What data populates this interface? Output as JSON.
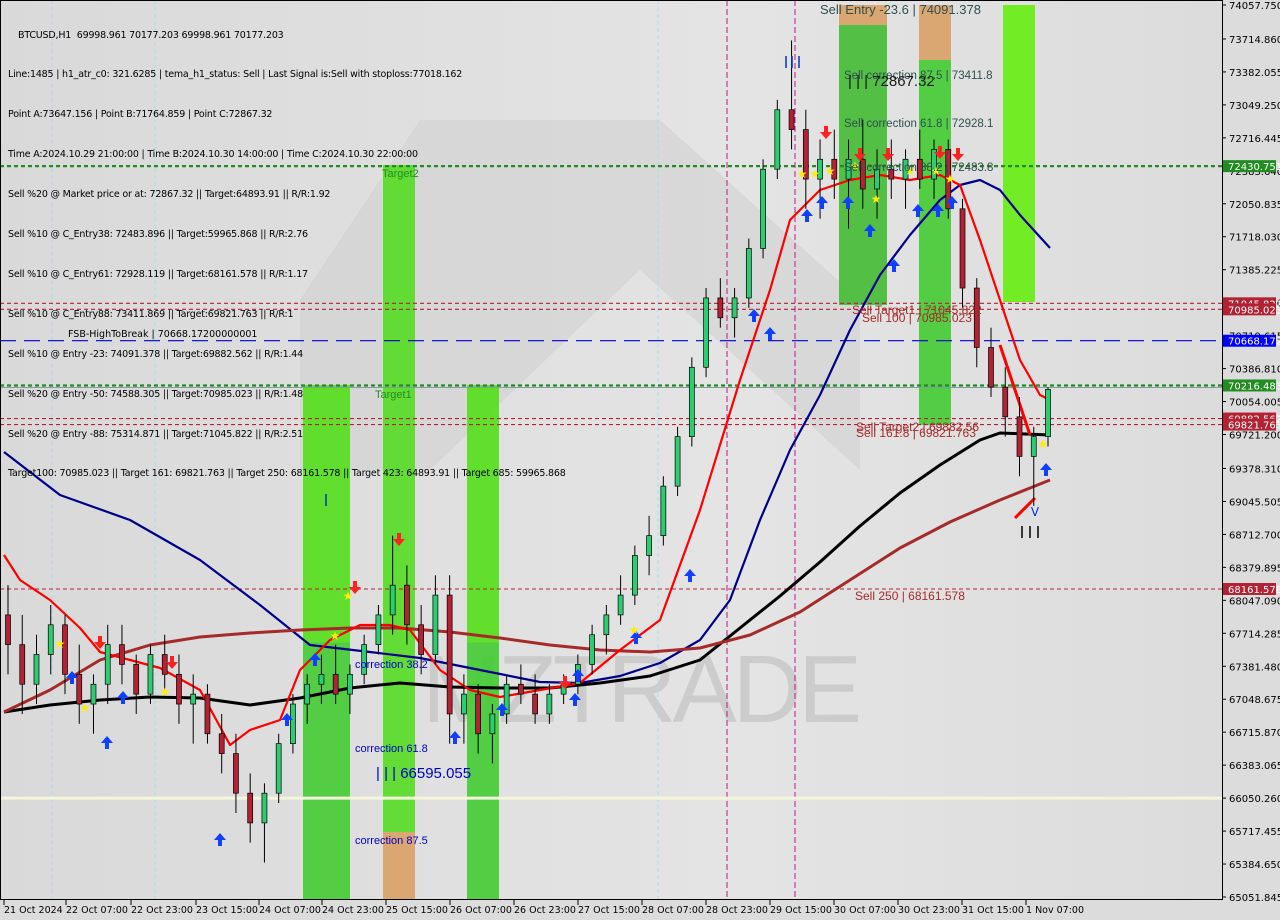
{
  "window": {
    "symbol": "BTCUSD,H1",
    "ohlc": "69998.961 70177.203 69998.961 70177.203"
  },
  "info_lines": [
    "Line:1485 | h1_atr_c0: 321.6285 | tema_h1_status: Sell | Last Signal is:Sell with stoploss:77018.162",
    "Point A:73647.156 | Point B:71764.859 | Point C:72867.32",
    "Time A:2024.10.29 21:00:00 | Time B:2024.10.30 14:00:00 | Time C:2024.10.30 22:00:00",
    "Sell %20 @ Market price or at: 72867.32 || Target:64893.91 || R/R:1.92",
    "Sell %10 @ C_Entry38: 72483.896 || Target:59965.868 || R/R:2.76",
    "Sell %10 @ C_Entry61: 72928.119 || Target:68161.578 || R/R:1.17",
    "Sell %10 @ C_Entry88: 73411.869 || Target:69821.763 || R/R:1",
    "Sell %10 @ Entry -23: 74091.378 || Target:69882.562 || R/R:1.44",
    "Sell %20 @ Entry -50: 74588.305 || Target:70985.023 || R/R:1.48",
    "Sell %20 @ Entry -88: 75314.871 || Target:71045.822 || R/R:2.51",
    "Target100: 70985.023 || Target 161: 69821.763 || Target 250: 68161.578 || Target 423: 64893.91 || Target 685: 59965.868"
  ],
  "colors": {
    "background": "#dcdcdc",
    "bull_candle": "#2ecc71",
    "bear_candle": "#b22234",
    "ema_fast": "#ff0000",
    "ema_mid": "#00008b",
    "ema_slow": "#000000",
    "ema_long": "#a52a2a",
    "green_zone": "#44cc33",
    "orange_zone": "#d9a066",
    "target_line": "#228b22",
    "sell_line": "#b22234",
    "fsb_line": "#0000cd",
    "buy_arrow": "#1040ff",
    "sell_arrow": "#ff2020",
    "star": "#ffee00"
  },
  "watermark": "MZTRADE",
  "chart_data": {
    "type": "candlestick",
    "title": "BTCUSD,H1",
    "xlabel": "",
    "ylabel": "",
    "ylim": [
      65051.845,
      74057.75
    ],
    "grid": false,
    "y_ticks": [
      "74057.750",
      "73714.860",
      "73382.055",
      "73049.250",
      "72716.445",
      "72383.640",
      "72050.835",
      "71718.030",
      "71385.225",
      "71052.420",
      "70719.615",
      "70386.810",
      "70054.005",
      "69721.200",
      "69378.310",
      "69045.505",
      "68712.700",
      "68379.895",
      "68047.090",
      "67714.285",
      "67381.480",
      "67048.675",
      "66715.870",
      "66383.065",
      "66050.260",
      "65717.455",
      "65384.650",
      "65051.845"
    ],
    "x_ticks": [
      "21 Oct 2024",
      "22 Oct 07:00",
      "22 Oct 23:00",
      "23 Oct 15:00",
      "24 Oct 07:00",
      "24 Oct 23:00",
      "25 Oct 15:00",
      "26 Oct 07:00",
      "26 Oct 23:00",
      "27 Oct 15:00",
      "28 Oct 07:00",
      "28 Oct 23:00",
      "29 Oct 15:00",
      "30 Oct 07:00",
      "30 Oct 23:00",
      "31 Oct 15:00",
      "1 Nov 07:00"
    ],
    "price_tags": [
      {
        "value": 72430.751,
        "label": "72430.751",
        "color": "#228b22"
      },
      {
        "value": 71045.822,
        "label": "71045.822",
        "color": "#b22234"
      },
      {
        "value": 70985.023,
        "label": "70985.023",
        "color": "#b22234"
      },
      {
        "value": 70668.172,
        "label": "70668.172",
        "color": "#0000ff"
      },
      {
        "value": 70216.483,
        "label": "70216.483",
        "color": "#228b22"
      },
      {
        "value": 69882.562,
        "label": "69882.562",
        "color": "#b22234"
      },
      {
        "value": 69821.763,
        "label": "69821.763",
        "color": "#b22234"
      },
      {
        "value": 68161.578,
        "label": "68161.578",
        "color": "#b22234"
      }
    ],
    "horizontal_lines": [
      {
        "value": 72430.751,
        "style": "dotted",
        "color": "#228b22",
        "label": "Target2"
      },
      {
        "value": 71045.822,
        "style": "dashed",
        "color": "#b22234",
        "label": "Sell Target1 | 71045.822"
      },
      {
        "value": 70985.023,
        "style": "dashed",
        "color": "#b22234",
        "label": "Sell 100 | 70985.023"
      },
      {
        "value": 70668.172,
        "style": "longdash",
        "color": "#0000cd",
        "label": "FSB-HighToBreak | 70668.17200000001"
      },
      {
        "value": 70216.483,
        "style": "dotted",
        "color": "#228b22",
        "label": "Target1"
      },
      {
        "value": 69882.562,
        "style": "dashed",
        "color": "#b22234",
        "label": "Sell Target2 | 69882.56"
      },
      {
        "value": 69821.763,
        "style": "dashed",
        "color": "#b22234",
        "label": "Sell 161.8 | 69821.763"
      },
      {
        "value": 68161.578,
        "style": "dashed",
        "color": "#b22234",
        "label": "Sell 250 | 68161.578"
      },
      {
        "value": 66050.26,
        "style": "solid",
        "color": "#f5f5dc",
        "label": ""
      }
    ],
    "annotations": [
      {
        "text": "Sell Entry -23.6 | 74091.378",
        "value": 74091.378
      },
      {
        "text": "Sell correction 87.5 | 73411.8",
        "value": 73411.8
      },
      {
        "text": "| | | 72867.32",
        "value": 72867.32
      },
      {
        "text": "Sell correction 61.8 | 72928.1",
        "value": 72928.1
      },
      {
        "text": "Sell correction 38.2 | 72483.8",
        "value": 72483.8
      },
      {
        "text": "correction 38.2",
        "value": 67400
      },
      {
        "text": "correction 61.8",
        "value": 66650
      },
      {
        "text": "| | | 66595.055",
        "value": 66595.055
      },
      {
        "text": "correction 87.5",
        "value": 65700
      }
    ],
    "candles_approx": [
      [
        67900,
        68200,
        67300,
        67600
      ],
      [
        67600,
        67900,
        66900,
        67200
      ],
      [
        67200,
        67700,
        67000,
        67500
      ],
      [
        67500,
        68000,
        67300,
        67800
      ],
      [
        67800,
        67900,
        67100,
        67300
      ],
      [
        67300,
        67600,
        66800,
        67000
      ],
      [
        67000,
        67300,
        66700,
        67200
      ],
      [
        67200,
        67800,
        67000,
        67600
      ],
      [
        67600,
        67800,
        67200,
        67400
      ],
      [
        67400,
        67500,
        66900,
        67100
      ],
      [
        67100,
        67600,
        67000,
        67500
      ],
      [
        67500,
        67700,
        67100,
        67300
      ],
      [
        67300,
        67500,
        66800,
        67000
      ],
      [
        67000,
        67300,
        66600,
        67100
      ],
      [
        67100,
        67200,
        66600,
        66700
      ],
      [
        66700,
        66900,
        66300,
        66500
      ],
      [
        66500,
        66700,
        65900,
        66100
      ],
      [
        66100,
        66300,
        65600,
        65800
      ],
      [
        65800,
        66200,
        65400,
        66100
      ],
      [
        66100,
        66700,
        66000,
        66600
      ],
      [
        66600,
        67100,
        66500,
        67000
      ],
      [
        67000,
        67300,
        66800,
        67200
      ],
      [
        67200,
        67500,
        67000,
        67300
      ],
      [
        67300,
        67600,
        67000,
        67100
      ],
      [
        67100,
        67400,
        66900,
        67300
      ],
      [
        67300,
        67700,
        67200,
        67600
      ],
      [
        67600,
        68000,
        67500,
        67900
      ],
      [
        67900,
        68700,
        67700,
        68200
      ],
      [
        68200,
        68400,
        67600,
        67800
      ],
      [
        67800,
        68000,
        67300,
        67500
      ],
      [
        67500,
        68300,
        67400,
        68100
      ],
      [
        68100,
        68300,
        66600,
        66900
      ],
      [
        66900,
        67300,
        66600,
        67100
      ],
      [
        67100,
        67200,
        66500,
        66700
      ],
      [
        66700,
        67000,
        66400,
        66900
      ],
      [
        66900,
        67300,
        66800,
        67200
      ],
      [
        67200,
        67400,
        67000,
        67100
      ],
      [
        67100,
        67300,
        66800,
        66900
      ],
      [
        66900,
        67200,
        66800,
        67100
      ],
      [
        67100,
        67300,
        67000,
        67200
      ],
      [
        67200,
        67500,
        67100,
        67400
      ],
      [
        67400,
        67800,
        67300,
        67700
      ],
      [
        67700,
        68000,
        67500,
        67900
      ],
      [
        67900,
        68300,
        67800,
        68100
      ],
      [
        68100,
        68600,
        68000,
        68500
      ],
      [
        68500,
        68900,
        68300,
        68700
      ],
      [
        68700,
        69300,
        68600,
        69200
      ],
      [
        69200,
        69800,
        69100,
        69700
      ],
      [
        69700,
        70500,
        69600,
        70400
      ],
      [
        70400,
        71200,
        70300,
        71100
      ],
      [
        71100,
        71300,
        70800,
        70900
      ],
      [
        70900,
        71200,
        70700,
        71100
      ],
      [
        71100,
        71700,
        71000,
        71600
      ],
      [
        71600,
        72500,
        71500,
        72400
      ],
      [
        72400,
        73100,
        72300,
        73000
      ],
      [
        73000,
        73700,
        72600,
        72800
      ],
      [
        72800,
        73000,
        72000,
        72300
      ],
      [
        72300,
        72700,
        71900,
        72500
      ],
      [
        72500,
        72800,
        72100,
        72300
      ],
      [
        72300,
        72700,
        71800,
        72500
      ],
      [
        72500,
        72900,
        72000,
        72200
      ],
      [
        72200,
        72600,
        71900,
        72400
      ],
      [
        72400,
        72700,
        72100,
        72300
      ],
      [
        72300,
        72600,
        72000,
        72500
      ],
      [
        72500,
        72800,
        72200,
        72300
      ],
      [
        72300,
        72700,
        72100,
        72600
      ],
      [
        72600,
        72700,
        71900,
        72000
      ],
      [
        72000,
        72100,
        71000,
        71200
      ],
      [
        71200,
        71300,
        70400,
        70600
      ],
      [
        70600,
        70800,
        70100,
        70200
      ],
      [
        70200,
        70400,
        69700,
        69900
      ],
      [
        69900,
        70100,
        69300,
        69500
      ],
      [
        69500,
        69800,
        69000,
        69700
      ],
      [
        69700,
        70200,
        69600,
        70177
      ]
    ]
  }
}
